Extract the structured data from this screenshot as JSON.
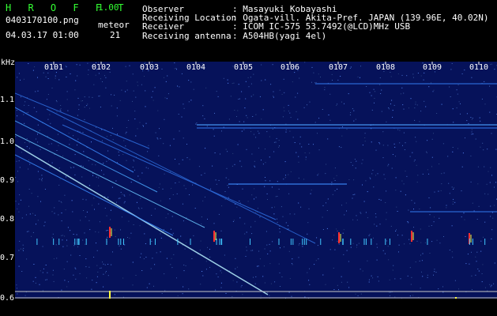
{
  "header": {
    "app_name": "H R O F F T",
    "version": "1.00",
    "filename": "0403170100.png",
    "datetime": "04.03.17 01:00",
    "meteor_label": "meteor",
    "meteor_count": "21",
    "observer_label": "Observer",
    "observer_value": ": Masayuki Kobayashi",
    "location_label": "Receiving Location",
    "location_value": ": Ogata-vill. Akita-Pref. JAPAN (139.96E, 40.02N)",
    "receiver_label": "Receiver",
    "receiver_value": ": ICOM IC-575 53.7492(@LCD)MHz USB",
    "antenna_label": "Receiving antenna",
    "antenna_value": ": A504HB(yagi 4el)"
  },
  "axis": {
    "unit": "kHz",
    "y_ticks": [
      "1.1",
      "1.0",
      "0.9",
      "0.8",
      "0.7",
      "0.6"
    ],
    "x_ticks": [
      "0101",
      "0102",
      "0103",
      "0104",
      "0105",
      "0106",
      "0107",
      "0108",
      "0109",
      "0110"
    ]
  },
  "colors": {
    "background": "#000000",
    "spectrum": "#06125a",
    "header_accent": "#33ff33",
    "text": "#ffffff"
  }
}
